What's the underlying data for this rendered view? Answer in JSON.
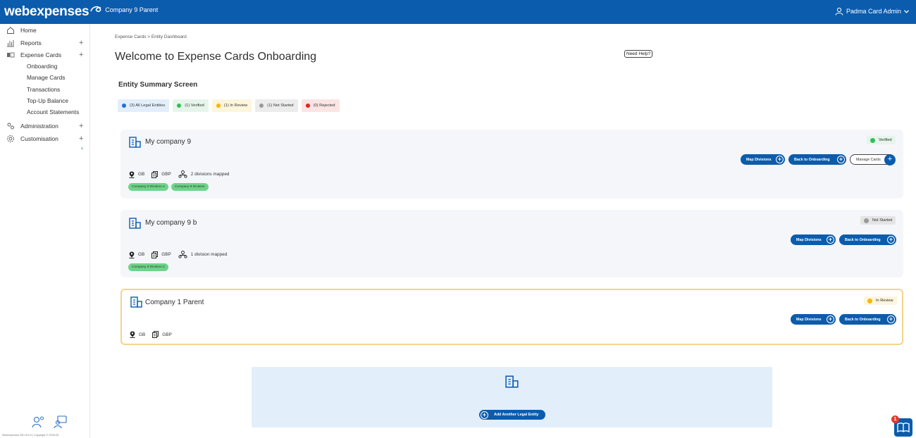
{
  "header": {
    "logo": "webexpenses",
    "org_name": "Company 9 Parent",
    "user_name": "Padma Card Admin"
  },
  "sidebar": {
    "items": [
      {
        "label": "Home",
        "icon": "home-icon"
      },
      {
        "label": "Reports",
        "icon": "reports-icon",
        "expand": "+"
      },
      {
        "label": "Expense Cards",
        "icon": "card-icon",
        "expand": "+"
      },
      {
        "label": "Administration",
        "icon": "admin-icon",
        "expand": "+"
      },
      {
        "label": "Customisation",
        "icon": "gear-icon",
        "expand": "+"
      }
    ],
    "subitems": [
      "Onboarding",
      "Manage Cards",
      "Transactions",
      "Top-Up Balance",
      "Account Statements"
    ],
    "collapse": "‹",
    "footer": "Webexpenses GB 15.0.0 | Copyright © 2005-25"
  },
  "breadcrumb": "Expense Cards  >  Entity Dashboard",
  "page_title": "Welcome to Expense Cards Onboarding",
  "help_label": "Need Help?",
  "section_title": "Entity Summary Screen",
  "filters": [
    {
      "label": "(3) All Legal Entities",
      "color": "#1f6fd6",
      "bg": "#e3eefb"
    },
    {
      "label": "(1) Verified",
      "color": "#2fbf5a",
      "bg": "#e6f5ea"
    },
    {
      "label": "(1) In Review",
      "color": "#f5b800",
      "bg": "#fdf5dc"
    },
    {
      "label": "(1) Not Started",
      "color": "#9a9a9a",
      "bg": "#ececec"
    },
    {
      "label": "(0) Rejected",
      "color": "#e0231c",
      "bg": "#fbe4e4"
    }
  ],
  "entities": [
    {
      "name": "My company 9",
      "status": "Verified",
      "status_color": "#2fbf5a",
      "status_bg": "#e6f5ea",
      "country": "GB",
      "currency": "GBP",
      "divisions": "2 divisions mapped",
      "tags": [
        "Company 9 Division A",
        "Company 9 Division"
      ],
      "buttons": {
        "map": "Map Divisions",
        "back": "Back to Onboarding",
        "manage": "Manage Cards"
      }
    },
    {
      "name": "My company 9 b",
      "status": "Not Started",
      "status_color": "#9a9a9a",
      "status_bg": "#e4e4e4",
      "country": "GB",
      "currency": "GBP",
      "divisions": "1 division mapped",
      "tags": [
        "Company 9 Division C"
      ],
      "buttons": {
        "map": "Map Divisions",
        "back": "Back to Onboarding"
      }
    },
    {
      "name": "Company 1 Parent",
      "status": "In Review",
      "status_color": "#f5b800",
      "status_bg": "#fdf5dc",
      "country": "GB",
      "currency": "GBP",
      "buttons": {
        "map": "Map Divisions",
        "back": "Back to Onboarding"
      }
    }
  ],
  "add_entity_label": "Add Another Legal Entity",
  "guide_badge": "1",
  "brand_color": "#0b5cad"
}
